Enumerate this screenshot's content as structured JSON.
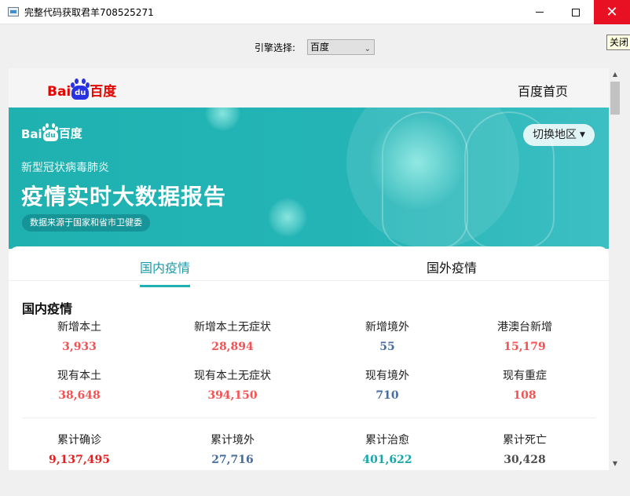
{
  "window": {
    "title": "完整代码获取君羊708525271",
    "close_tooltip": "关闭"
  },
  "engine": {
    "label": "引擎选择:",
    "selected": "百度"
  },
  "page": {
    "logo_text_left": "Bai",
    "logo_text_mid": "du",
    "logo_text_right": "百度",
    "home_link": "百度首页"
  },
  "banner": {
    "logo_left": "Bai",
    "logo_mid": "du",
    "logo_right": "百度",
    "subtitle": "新型冠状病毒肺炎",
    "title": "疫情实时大数据报告",
    "source": "数据来源于国家和省市卫健委",
    "switch_region": "切换地区"
  },
  "tabs": {
    "domestic": "国内疫情",
    "foreign": "国外疫情"
  },
  "section": {
    "title": "国内疫情"
  },
  "stats": [
    {
      "label": "新增本土",
      "value": "3,933",
      "color": "#f55253"
    },
    {
      "label": "新增本土无症状",
      "value": "28,894",
      "color": "#f55253"
    },
    {
      "label": "新增境外",
      "value": "55",
      "color": "#476da0"
    },
    {
      "label": "港澳台新增",
      "value": "15,179",
      "color": "#f55253"
    },
    {
      "label": "现有本土",
      "value": "38,648",
      "color": "#f55253"
    },
    {
      "label": "现有本土无症状",
      "value": "394,150",
      "color": "#f55253"
    },
    {
      "label": "现有境外",
      "value": "710",
      "color": "#476da0"
    },
    {
      "label": "现有重症",
      "value": "108",
      "color": "#f55253"
    },
    {
      "label": "累计确诊",
      "value": "9,137,495",
      "color": "#e02222"
    },
    {
      "label": "累计境外",
      "value": "27,716",
      "color": "#476da0"
    },
    {
      "label": "累计治愈",
      "value": "401,622",
      "color": "#19a6a8"
    },
    {
      "label": "累计死亡",
      "value": "30,428",
      "color": "#4d4d4d"
    }
  ]
}
